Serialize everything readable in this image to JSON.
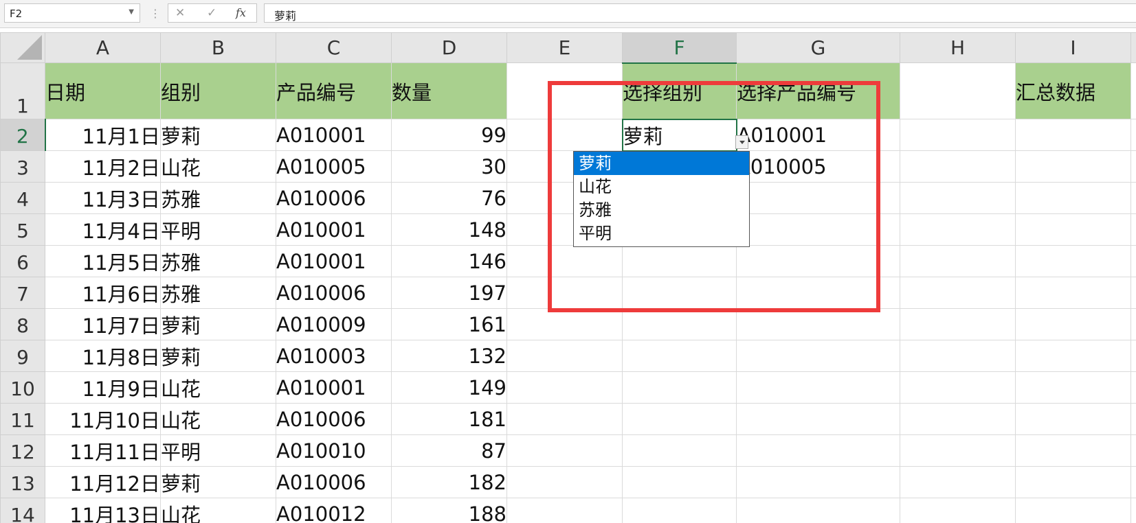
{
  "formula_bar": {
    "name_box": "F2",
    "fx_label": "fx",
    "cancel_glyph": "✕",
    "enter_glyph": "✓",
    "content": "萝莉"
  },
  "columns": [
    "A",
    "B",
    "C",
    "D",
    "E",
    "F",
    "G",
    "H",
    "I"
  ],
  "selected_column": "F",
  "selected_row": "2",
  "headers": {
    "date": "日期",
    "group": "组别",
    "product": "产品编号",
    "qty": "数量",
    "select_group": "选择组别",
    "select_product": "选择产品编号",
    "summary": "汇总数据"
  },
  "rows": [
    {
      "num": "2",
      "date": "11月1日",
      "group": "萝莉",
      "product": "A010001",
      "qty": "99"
    },
    {
      "num": "3",
      "date": "11月2日",
      "group": "山花",
      "product": "A010005",
      "qty": "30"
    },
    {
      "num": "4",
      "date": "11月3日",
      "group": "苏雅",
      "product": "A010006",
      "qty": "76"
    },
    {
      "num": "5",
      "date": "11月4日",
      "group": "平明",
      "product": "A010001",
      "qty": "148"
    },
    {
      "num": "6",
      "date": "11月5日",
      "group": "苏雅",
      "product": "A010001",
      "qty": "146"
    },
    {
      "num": "7",
      "date": "11月6日",
      "group": "苏雅",
      "product": "A010006",
      "qty": "197"
    },
    {
      "num": "8",
      "date": "11月7日",
      "group": "萝莉",
      "product": "A010009",
      "qty": "161"
    },
    {
      "num": "9",
      "date": "11月8日",
      "group": "萝莉",
      "product": "A010003",
      "qty": "132"
    },
    {
      "num": "10",
      "date": "11月9日",
      "group": "山花",
      "product": "A010001",
      "qty": "149"
    },
    {
      "num": "11",
      "date": "11月10日",
      "group": "山花",
      "product": "A010006",
      "qty": "181"
    },
    {
      "num": "12",
      "date": "11月11日",
      "group": "平明",
      "product": "A010010",
      "qty": "87"
    },
    {
      "num": "13",
      "date": "11月12日",
      "group": "萝莉",
      "product": "A010006",
      "qty": "182"
    },
    {
      "num": "14",
      "date": "11月13日",
      "group": "山花",
      "product": "A010012",
      "qty": "188"
    }
  ],
  "row1_num": "1",
  "selection": {
    "f2": "萝莉",
    "g2": "A010001",
    "g3": "A010005"
  },
  "dropdown": {
    "options": [
      "萝莉",
      "山花",
      "苏雅",
      "平明"
    ],
    "highlighted": "萝莉"
  },
  "colors": {
    "header_fill": "#a9d08e",
    "active_border": "#217346",
    "dropdown_highlight": "#0078d7",
    "annotation_red": "#ee3b3b"
  }
}
